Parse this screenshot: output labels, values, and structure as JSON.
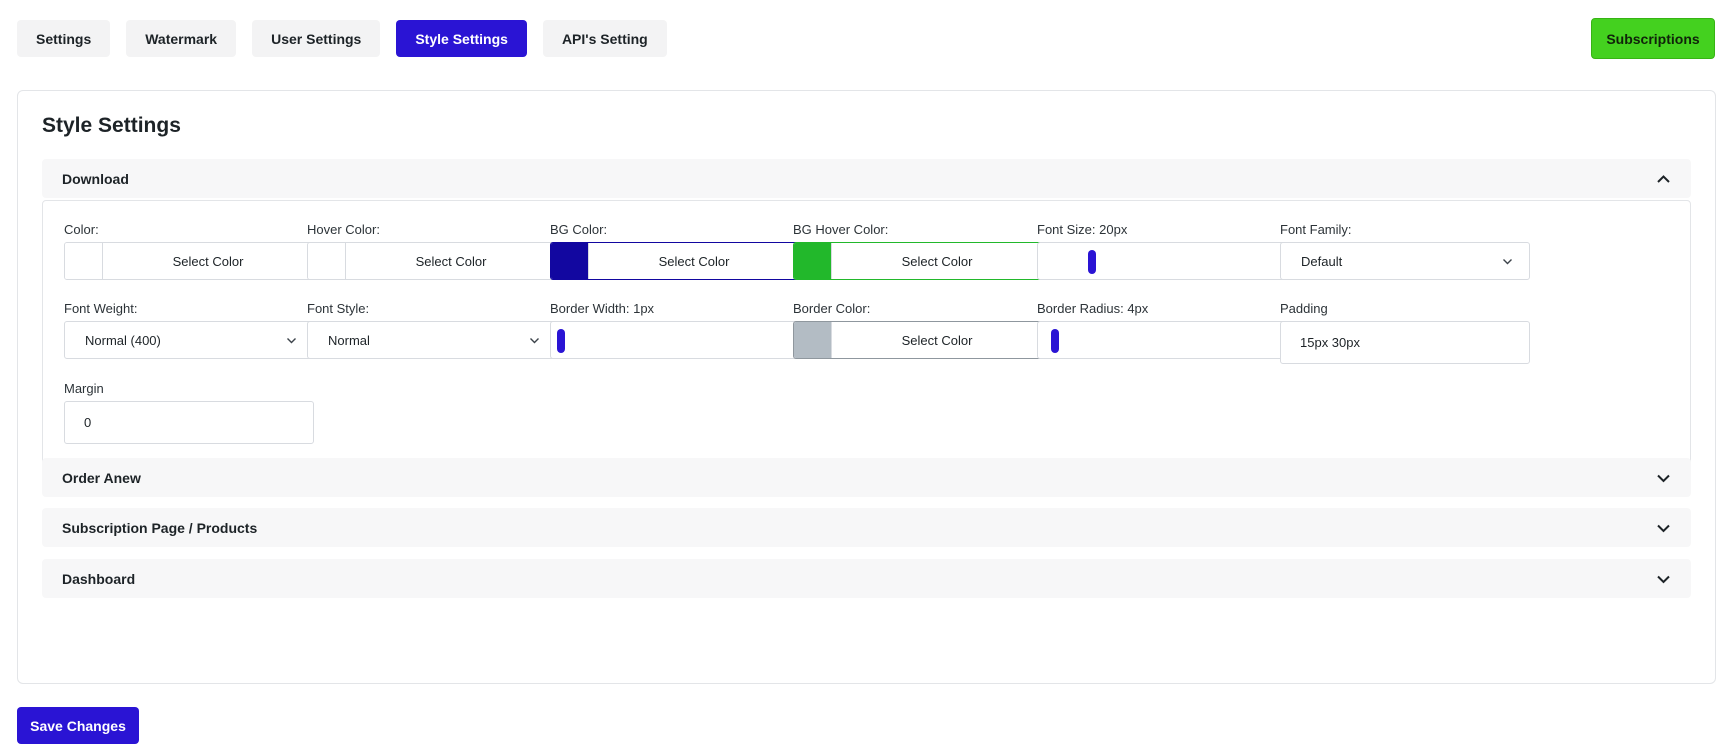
{
  "tabs": [
    {
      "label": "Settings",
      "active": false
    },
    {
      "label": "Watermark",
      "active": false
    },
    {
      "label": "User Settings",
      "active": false
    },
    {
      "label": "Style Settings",
      "active": true
    },
    {
      "label": "API's Setting",
      "active": false
    }
  ],
  "subscriptions_button": "Subscriptions",
  "panel_title": "Style Settings",
  "sections": {
    "download": {
      "title": "Download",
      "expanded": true
    },
    "order_anew": {
      "title": "Order Anew",
      "expanded": false
    },
    "subscription_page": {
      "title": "Subscription Page / Products",
      "expanded": false
    },
    "dashboard": {
      "title": "Dashboard",
      "expanded": false
    }
  },
  "fields": {
    "color": {
      "label": "Color:",
      "button": "Select Color",
      "swatch": "#ffffff",
      "border": "#d8dbe0"
    },
    "hover_color": {
      "label": "Hover Color:",
      "button": "Select Color",
      "swatch": "#ffffff",
      "border": "#d8dbe0"
    },
    "bg_color": {
      "label": "BG Color:",
      "button": "Select Color",
      "swatch": "#1207a0",
      "border": "#1207a0"
    },
    "bg_hover_color": {
      "label": "BG Hover Color:",
      "button": "Select Color",
      "swatch": "#22b82b",
      "border": "#22b82b"
    },
    "font_size": {
      "label": "Font Size: 20px",
      "value": 20,
      "min": 0,
      "max": 100
    },
    "font_family": {
      "label": "Font Family:",
      "value": "Default"
    },
    "font_weight": {
      "label": "Font Weight:",
      "value": "Normal (400)"
    },
    "font_style": {
      "label": "Font Style:",
      "value": "Normal"
    },
    "border_width": {
      "label": "Border Width: 1px",
      "value": 1,
      "min": 0,
      "max": 100
    },
    "border_color": {
      "label": "Border Color:",
      "button": "Select Color",
      "swatch": "#b3bcc4",
      "border": "#8f979e"
    },
    "border_radius": {
      "label": "Border Radius: 4px",
      "value": 4,
      "min": 0,
      "max": 100
    },
    "padding": {
      "label": "Padding",
      "value": "15px 30px"
    },
    "margin": {
      "label": "Margin",
      "value": "0"
    }
  },
  "save_button": "Save Changes",
  "colors": {
    "accent": "#2a14d4",
    "subscriptions": "#44d11f"
  }
}
